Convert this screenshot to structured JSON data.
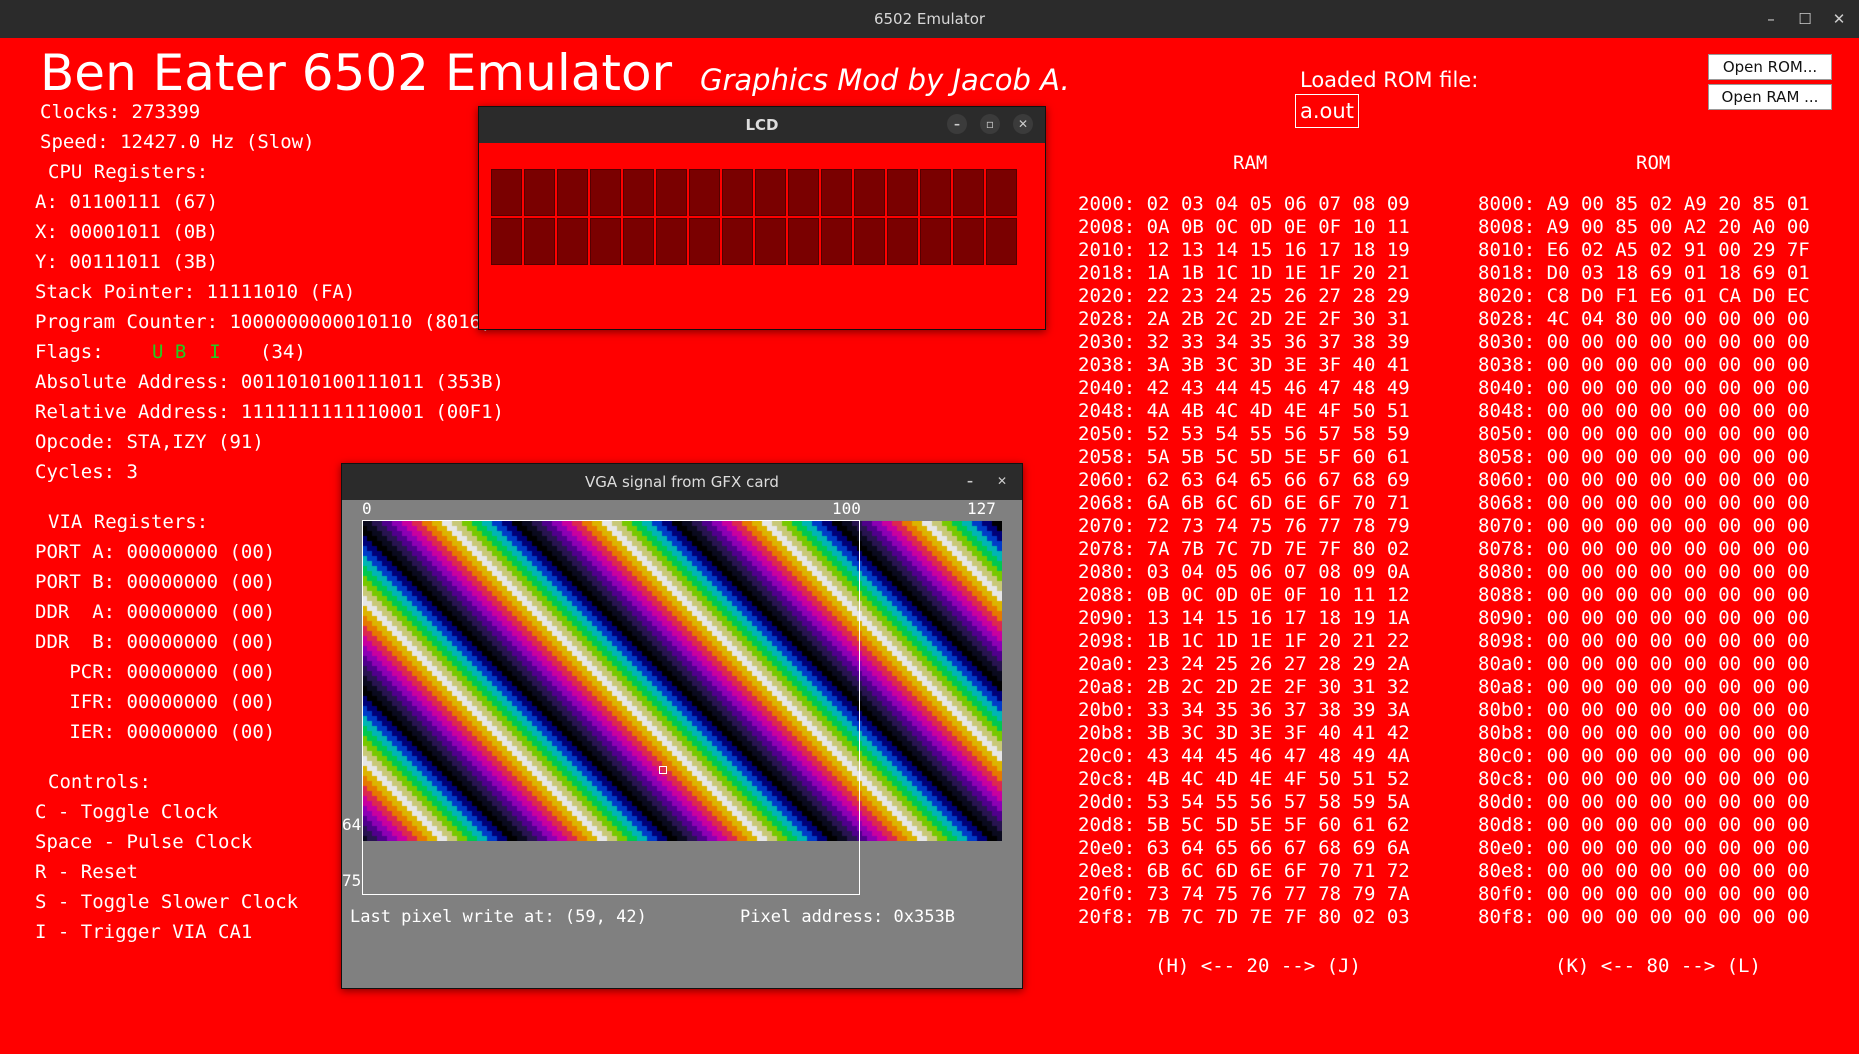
{
  "window": {
    "title": "6502 Emulator",
    "min": "–",
    "max": "☐",
    "close": "✕"
  },
  "header": {
    "title": "Ben Eater 6502 Emulator",
    "subtitle": "Graphics Mod by Jacob A.",
    "loaded_label": "Loaded ROM file:",
    "loaded_file": "a.out",
    "open_rom": "Open ROM...",
    "open_ram": "Open RAM ..."
  },
  "cpu": {
    "clocks": "Clocks: 273399",
    "speed": "Speed: 12427.0 Hz (Slow)",
    "heading": "CPU Registers:",
    "a": "A: 01100111 (67)",
    "x": "X: 00001011 (0B)",
    "y": "Y: 00111011 (3B)",
    "sp": "Stack Pointer: 11111010 (FA)",
    "pc": "Program Counter: 1000000000010110 (8016)",
    "flags_label": "Flags:",
    "flags_set": "U B  I",
    "flags_value": "(34)",
    "abs": "Absolute Address: 0011010100111011 (353B)",
    "rel": "Relative Address: 1111111111110001 (00F1)",
    "opcode": "Opcode: STA,IZY (91)",
    "cycles": "Cycles: 3"
  },
  "via": {
    "heading": "VIA Registers:",
    "porta": "PORT A: 00000000 (00)",
    "portb": "PORT B: 00000000 (00)",
    "ddra": "DDR  A: 00000000 (00)",
    "ddrb": "DDR  B: 00000000 (00)",
    "pcr": "   PCR: 00000000 (00)",
    "ifr": "   IFR: 00000000 (00)",
    "ier": "   IER: 00000000 (00)"
  },
  "controls": {
    "heading": "Controls:",
    "c": "C - Toggle Clock",
    "space": "Space - Pulse Clock",
    "r": "R - Reset",
    "s": "S - Toggle Slower Clock",
    "i": "I - Trigger VIA CA1"
  },
  "lcd": {
    "title": "LCD",
    "cols": 16,
    "rows": 2
  },
  "vga": {
    "title": "VGA signal from GFX card",
    "x0": "0",
    "x100": "100",
    "x127": "127",
    "y64": "64",
    "y75": "75",
    "last_write": "Last pixel write at: (59, 42)",
    "pixel_addr": "Pixel address: 0x353B"
  },
  "ram": {
    "heading": "RAM",
    "lines": [
      "2000: 02 03 04 05 06 07 08 09",
      "2008: 0A 0B 0C 0D 0E 0F 10 11",
      "2010: 12 13 14 15 16 17 18 19",
      "2018: 1A 1B 1C 1D 1E 1F 20 21",
      "2020: 22 23 24 25 26 27 28 29",
      "2028: 2A 2B 2C 2D 2E 2F 30 31",
      "2030: 32 33 34 35 36 37 38 39",
      "2038: 3A 3B 3C 3D 3E 3F 40 41",
      "2040: 42 43 44 45 46 47 48 49",
      "2048: 4A 4B 4C 4D 4E 4F 50 51",
      "2050: 52 53 54 55 56 57 58 59",
      "2058: 5A 5B 5C 5D 5E 5F 60 61",
      "2060: 62 63 64 65 66 67 68 69",
      "2068: 6A 6B 6C 6D 6E 6F 70 71",
      "2070: 72 73 74 75 76 77 78 79",
      "2078: 7A 7B 7C 7D 7E 7F 80 02",
      "2080: 03 04 05 06 07 08 09 0A",
      "2088: 0B 0C 0D 0E 0F 10 11 12",
      "2090: 13 14 15 16 17 18 19 1A",
      "2098: 1B 1C 1D 1E 1F 20 21 22",
      "20a0: 23 24 25 26 27 28 29 2A",
      "20a8: 2B 2C 2D 2E 2F 30 31 32",
      "20b0: 33 34 35 36 37 38 39 3A",
      "20b8: 3B 3C 3D 3E 3F 40 41 42",
      "20c0: 43 44 45 46 47 48 49 4A",
      "20c8: 4B 4C 4D 4E 4F 50 51 52",
      "20d0: 53 54 55 56 57 58 59 5A",
      "20d8: 5B 5C 5D 5E 5F 60 61 62",
      "20e0: 63 64 65 66 67 68 69 6A",
      "20e8: 6B 6C 6D 6E 6F 70 71 72",
      "20f0: 73 74 75 76 77 78 79 7A",
      "20f8: 7B 7C 7D 7E 7F 80 02 03"
    ],
    "nav": "(H) <-- 20 --> (J)"
  },
  "rom": {
    "heading": "ROM",
    "lines": [
      "8000: A9 00 85 02 A9 20 85 01",
      "8008: A9 00 85 00 A2 20 A0 00",
      "8010: E6 02 A5 02 91 00 29 7F",
      "8018: D0 03 18 69 01 18 69 01",
      "8020: C8 D0 F1 E6 01 CA D0 EC",
      "8028: 4C 04 80 00 00 00 00 00",
      "8030: 00 00 00 00 00 00 00 00",
      "8038: 00 00 00 00 00 00 00 00",
      "8040: 00 00 00 00 00 00 00 00",
      "8048: 00 00 00 00 00 00 00 00",
      "8050: 00 00 00 00 00 00 00 00",
      "8058: 00 00 00 00 00 00 00 00",
      "8060: 00 00 00 00 00 00 00 00",
      "8068: 00 00 00 00 00 00 00 00",
      "8070: 00 00 00 00 00 00 00 00",
      "8078: 00 00 00 00 00 00 00 00",
      "8080: 00 00 00 00 00 00 00 00",
      "8088: 00 00 00 00 00 00 00 00",
      "8090: 00 00 00 00 00 00 00 00",
      "8098: 00 00 00 00 00 00 00 00",
      "80a0: 00 00 00 00 00 00 00 00",
      "80a8: 00 00 00 00 00 00 00 00",
      "80b0: 00 00 00 00 00 00 00 00",
      "80b8: 00 00 00 00 00 00 00 00",
      "80c0: 00 00 00 00 00 00 00 00",
      "80c8: 00 00 00 00 00 00 00 00",
      "80d0: 00 00 00 00 00 00 00 00",
      "80d8: 00 00 00 00 00 00 00 00",
      "80e0: 00 00 00 00 00 00 00 00",
      "80e8: 00 00 00 00 00 00 00 00",
      "80f0: 00 00 00 00 00 00 00 00",
      "80f8: 00 00 00 00 00 00 00 00"
    ],
    "nav": "(K) <-- 80 --> (L)"
  }
}
